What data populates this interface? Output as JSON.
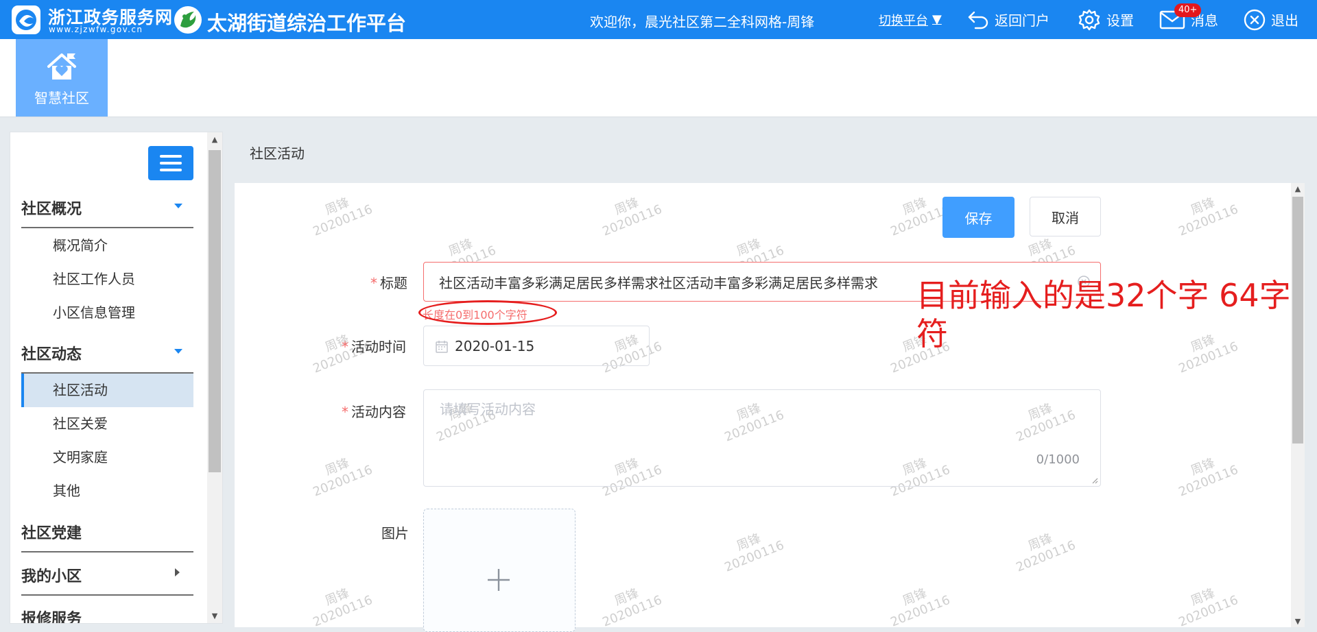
{
  "header": {
    "gov_name": "浙江政务服务网",
    "gov_url": "www.zjzwfw.gov.cn",
    "platform_title": "太湖街道综治工作平台",
    "welcome": "欢迎你，晨光社区第二全科网格-周锋",
    "switch_label": "切换平台",
    "switch_caret": "▼",
    "portal_label": "返回门户",
    "settings_label": "设置",
    "messages_label": "消息",
    "messages_badge": "40+",
    "logout_label": "退出"
  },
  "module": {
    "label": "智慧社区"
  },
  "sidebar": {
    "groups": [
      {
        "title": "社区概况",
        "items": [
          "概况简介",
          "社区工作人员",
          "小区信息管理"
        ]
      },
      {
        "title": "社区动态",
        "items": [
          "社区活动",
          "社区关爱",
          "文明家庭",
          "其他"
        ]
      },
      {
        "title": "社区党建"
      },
      {
        "title": "我的小区"
      },
      {
        "title": "报修服务"
      }
    ],
    "active_item": "社区活动"
  },
  "breadcrumb": "社区活动",
  "form": {
    "save_label": "保存",
    "cancel_label": "取消",
    "required_mark": "*",
    "title_label": "标题",
    "title_value": "社区活动丰富多彩满足居民多样需求社区活动丰富多彩满足居民多样需求",
    "title_error": "长度在0到100个字符",
    "date_label": "活动时间",
    "date_value": "2020-01-15",
    "content_label": "活动内容",
    "content_placeholder": "请填写活动内容",
    "content_counter": "0/1000",
    "image_label": "图片"
  },
  "annotation": "目前输入的是32个字 64字符",
  "watermark": {
    "name": "周锋",
    "date": "20200116"
  },
  "colors": {
    "primary": "#1a86f1",
    "button": "#409eff",
    "error": "#f56c6c",
    "annotation": "#e51e1e"
  }
}
